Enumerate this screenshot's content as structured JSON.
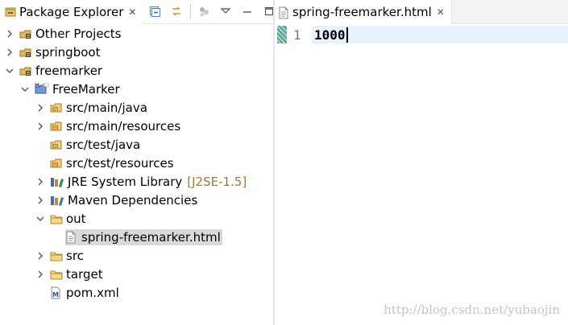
{
  "package_explorer": {
    "tab_label": "Package Explorer",
    "close_glyph": "✕",
    "toolbar": {
      "collapse_all": "collapse-all-icon",
      "link_editor": "link-with-editor-icon",
      "focus": "focus-on-active-task-icon",
      "view_menu": "view-menu-icon",
      "minimize": "minimize-icon",
      "maximize": "maximize-icon"
    },
    "tree": [
      {
        "label": "Other Projects",
        "icon": "working-set-icon",
        "expander": "collapsed"
      },
      {
        "label": "springboot",
        "icon": "working-set-icon",
        "expander": "collapsed"
      },
      {
        "label": "freemarker",
        "icon": "working-set-icon",
        "expander": "expanded"
      },
      {
        "label": "FreeMarker",
        "icon": "maven-project-icon",
        "expander": "expanded"
      },
      {
        "label": "src/main/java",
        "icon": "source-folder-icon",
        "expander": "collapsed"
      },
      {
        "label": "src/main/resources",
        "icon": "source-folder-icon",
        "expander": "collapsed"
      },
      {
        "label": "src/test/java",
        "icon": "source-folder-icon",
        "expander": "none"
      },
      {
        "label": "src/test/resources",
        "icon": "source-folder-icon",
        "expander": "none"
      },
      {
        "label": "JRE System Library",
        "decoration": "[J2SE-1.5]",
        "icon": "library-icon",
        "expander": "collapsed"
      },
      {
        "label": "Maven Dependencies",
        "icon": "library-icon",
        "expander": "collapsed"
      },
      {
        "label": "out",
        "icon": "folder-icon",
        "expander": "expanded"
      },
      {
        "label": "spring-freemarker.html",
        "icon": "html-file-icon",
        "expander": "none",
        "selected": true
      },
      {
        "label": "src",
        "icon": "folder-icon",
        "expander": "collapsed"
      },
      {
        "label": "target",
        "icon": "folder-icon",
        "expander": "collapsed"
      },
      {
        "label": "pom.xml",
        "icon": "maven-pom-icon",
        "expander": "none"
      }
    ]
  },
  "editor": {
    "tab_label": "spring-freemarker.html",
    "close_glyph": "✕",
    "lines": [
      {
        "number": "1",
        "text": "1000"
      }
    ]
  },
  "watermark": "http://blog.csdn.net/yubaojin",
  "colors": {
    "selection": "#d9d9d9",
    "current_line": "#e8f2fe",
    "decoration_text": "#9a7b3b",
    "change_marker": "#4fa095"
  }
}
